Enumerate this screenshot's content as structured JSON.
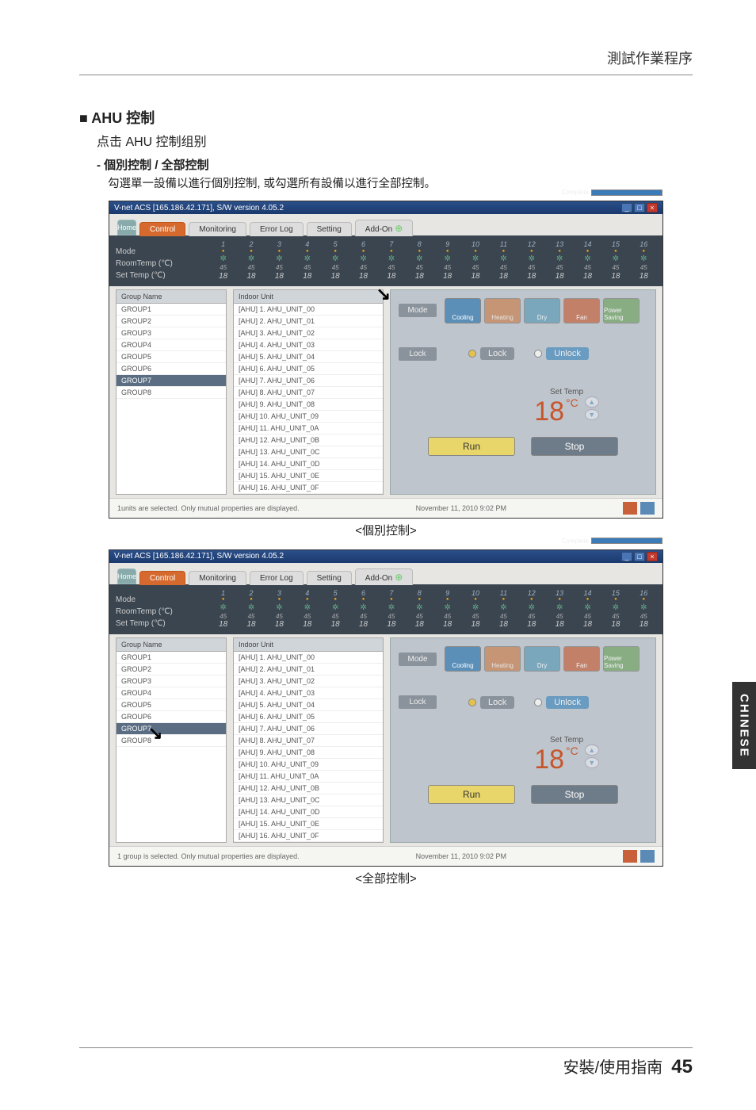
{
  "header": {
    "breadcrumb": "測試作業程序"
  },
  "section": {
    "title_marker": "■",
    "title": "AHU 控制",
    "subtitle": "点击 AHU 控制组别",
    "mode_title": "- 個別控制 / 全部控制",
    "mode_body": "勾選單一設備以進行個別控制, 或勾選所有設備以進行全部控制。"
  },
  "window": {
    "title": "V-net ACS [165.186.42.171],    S/W version 4.05.2",
    "tabs": {
      "home": "Home",
      "control": "Control",
      "monitoring": "Monitoring",
      "errorlog": "Error Log",
      "setting": "Setting",
      "addon": "Add-On"
    },
    "status": {
      "mode": "Mode",
      "roomtemp": "RoomTemp (℃)",
      "settemp": "Set Temp   (℃)",
      "value45": "45",
      "value18": "18",
      "slot_count": 16
    },
    "group_header": "Group Name",
    "groups": [
      "GROUP1",
      "GROUP2",
      "GROUP3",
      "GROUP4",
      "GROUP5",
      "GROUP6",
      "GROUP7",
      "GROUP8"
    ],
    "selected_group": "GROUP7",
    "unit_header": "Indoor Unit",
    "units": [
      "[AHU] 1. AHU_UNIT_00",
      "[AHU] 2. AHU_UNIT_01",
      "[AHU] 3. AHU_UNIT_02",
      "[AHU] 4. AHU_UNIT_03",
      "[AHU] 5. AHU_UNIT_04",
      "[AHU] 6. AHU_UNIT_05",
      "[AHU] 7. AHU_UNIT_06",
      "[AHU] 8. AHU_UNIT_07",
      "[AHU] 9. AHU_UNIT_08",
      "[AHU] 10. AHU_UNIT_09",
      "[AHU] 11. AHU_UNIT_0A",
      "[AHU] 12. AHU_UNIT_0B",
      "[AHU] 13. AHU_UNIT_0C",
      "[AHU] 14. AHU_UNIT_0D",
      "[AHU] 15. AHU_UNIT_0E",
      "[AHU] 16. AHU_UNIT_0F"
    ],
    "control": {
      "complete": "Complete",
      "mode_label": "Mode",
      "modes": {
        "cooling": "Cooling",
        "heating": "Heating",
        "dry": "Dry",
        "fan": "Fan",
        "power_saving": "Power Saving"
      },
      "lock_label": "Lock",
      "lock": "Lock",
      "unlock": "Unlock",
      "settemp_label": "Set Temp",
      "settemp_value": "18",
      "settemp_unit": "°C",
      "run": "Run",
      "stop": "Stop"
    },
    "footer1": "1units are selected. Only mutual properties are displayed.",
    "footer2": "1 group is selected. Only mutual properties are displayed.",
    "timestamp": "November 11, 2010  9:02 PM"
  },
  "caption1": "<個別控制>",
  "caption2": "<全部控制>",
  "side_tab": "CHINESE",
  "footer": {
    "text": "安裝/使用指南",
    "page": "45"
  }
}
